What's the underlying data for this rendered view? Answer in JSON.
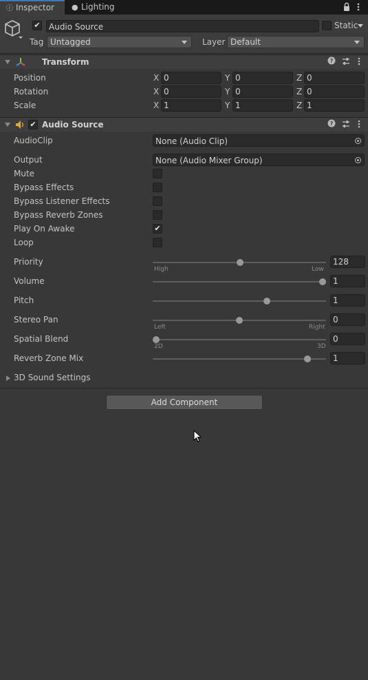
{
  "tabs": [
    {
      "label": "Inspector",
      "icon": "info-icon",
      "active": true
    },
    {
      "label": "Lighting",
      "icon": "lightbulb-icon",
      "active": false
    }
  ],
  "gameobject": {
    "name": "Audio Source",
    "active": true,
    "static_label": "Static",
    "tag_label": "Tag",
    "tag_value": "Untagged",
    "layer_label": "Layer",
    "layer_value": "Default"
  },
  "transform": {
    "title": "Transform",
    "rows": [
      {
        "label": "Position",
        "x": "0",
        "y": "0",
        "z": "0"
      },
      {
        "label": "Rotation",
        "x": "0",
        "y": "0",
        "z": "0"
      },
      {
        "label": "Scale",
        "x": "1",
        "y": "1",
        "z": "1"
      }
    ],
    "axis_x": "X",
    "axis_y": "Y",
    "axis_z": "Z"
  },
  "audio_source": {
    "title": "Audio Source",
    "enabled": true,
    "audioclip_label": "AudioClip",
    "audioclip_value": "None (Audio Clip)",
    "output_label": "Output",
    "output_value": "None (Audio Mixer Group)",
    "toggles": [
      {
        "label": "Mute",
        "checked": false
      },
      {
        "label": "Bypass Effects",
        "checked": false
      },
      {
        "label": "Bypass Listener Effects",
        "checked": false
      },
      {
        "label": "Bypass Reverb Zones",
        "checked": false
      },
      {
        "label": "Play On Awake",
        "checked": true,
        "mark": "✔"
      },
      {
        "label": "Loop",
        "checked": false
      }
    ],
    "sliders": [
      {
        "label": "Priority",
        "value": "128",
        "fraction": 0.5039,
        "left_sub": "High",
        "right_sub": "Low"
      },
      {
        "label": "Volume",
        "value": "1",
        "fraction": 1.0
      },
      {
        "label": "Pitch",
        "value": "1",
        "fraction": 0.6667
      },
      {
        "label": "Stereo Pan",
        "value": "0",
        "fraction": 0.5,
        "left_sub": "Left",
        "right_sub": "Right"
      },
      {
        "label": "Spatial Blend",
        "value": "0",
        "fraction": 0.0,
        "left_sub": "2D",
        "right_sub": "3D"
      },
      {
        "label": "Reverb Zone Mix",
        "value": "1",
        "fraction": 0.9091
      }
    ],
    "sound_settings_label": "3D Sound Settings"
  },
  "add_component_label": "Add Component",
  "colors": {
    "accent": "#3a79bb",
    "audio_icon": "#e8a72a"
  }
}
